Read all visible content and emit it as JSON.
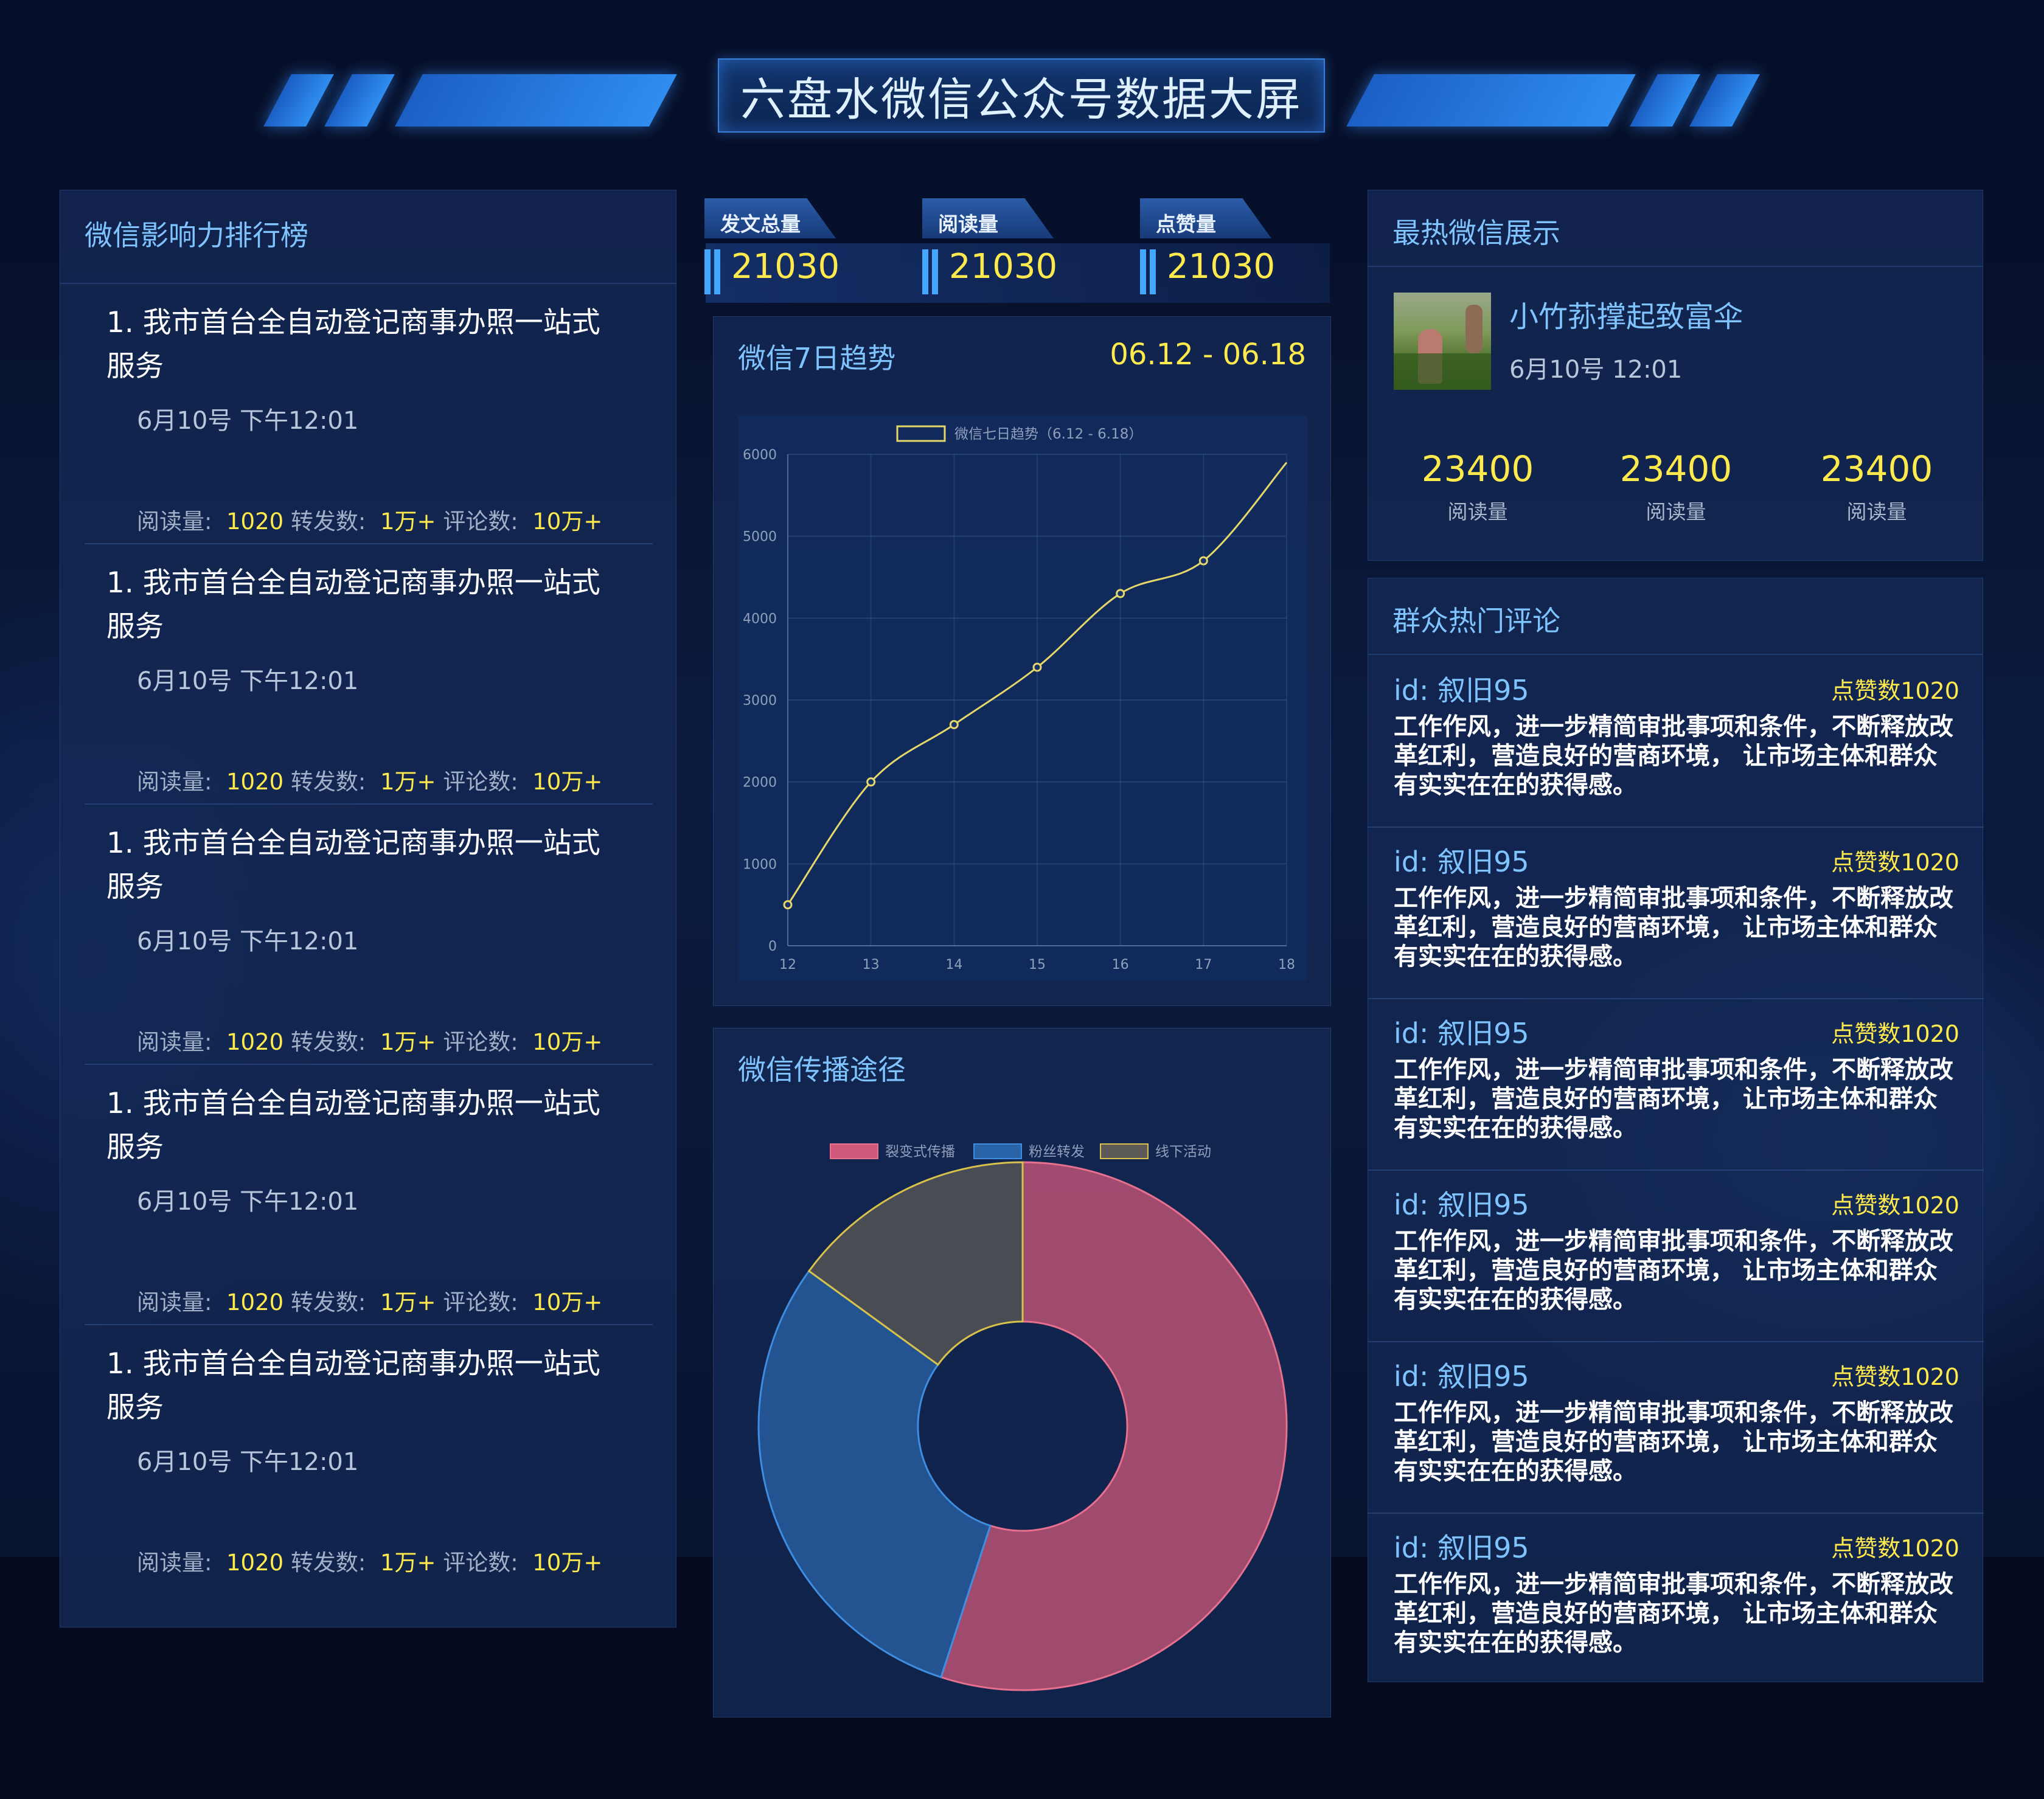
{
  "header": {
    "title": "六盘水微信公众号数据大屏"
  },
  "ranking": {
    "title": "微信影响力排行榜",
    "items": [
      {
        "title": "1. 我市首台全自动登记商事办照一站式服务",
        "date": "6月10号 下午12:01",
        "read_label": "阅读量:",
        "read": "1020",
        "share_label": "转发数:",
        "share": "1万+",
        "comment_label": "评论数:",
        "comment": "10万+"
      },
      {
        "title": "1. 我市首台全自动登记商事办照一站式服务",
        "date": "6月10号 下午12:01",
        "read_label": "阅读量:",
        "read": "1020",
        "share_label": "转发数:",
        "share": "1万+",
        "comment_label": "评论数:",
        "comment": "10万+"
      },
      {
        "title": "1. 我市首台全自动登记商事办照一站式服务",
        "date": "6月10号 下午12:01",
        "read_label": "阅读量:",
        "read": "1020",
        "share_label": "转发数:",
        "share": "1万+",
        "comment_label": "评论数:",
        "comment": "10万+"
      },
      {
        "title": "1. 我市首台全自动登记商事办照一站式服务",
        "date": "6月10号 下午12:01",
        "read_label": "阅读量:",
        "read": "1020",
        "share_label": "转发数:",
        "share": "1万+",
        "comment_label": "评论数:",
        "comment": "10万+"
      },
      {
        "title": "1. 我市首台全自动登记商事办照一站式服务",
        "date": "6月10号 下午12:01",
        "read_label": "阅读量:",
        "read": "1020",
        "share_label": "转发数:",
        "share": "1万+",
        "comment_label": "评论数:",
        "comment": "10万+"
      }
    ]
  },
  "stats": [
    {
      "label": "发文总量",
      "value": "21030"
    },
    {
      "label": "阅读量",
      "value": "21030"
    },
    {
      "label": "点赞量",
      "value": "21030"
    }
  ],
  "trend": {
    "title": "微信7日趋势",
    "range": "06.12 - 06.18"
  },
  "pie_panel": {
    "title": "微信传播途径"
  },
  "hot": {
    "title": "最热微信展示",
    "name": "小竹荪撑起致富伞",
    "date": "6月10号 12:01",
    "stats": [
      {
        "value": "23400",
        "label": "阅读量"
      },
      {
        "value": "23400",
        "label": "阅读量"
      },
      {
        "value": "23400",
        "label": "阅读量"
      }
    ]
  },
  "comments": {
    "title": "群众热门评论",
    "items": [
      {
        "id": "id: 叙旧95",
        "likes": "点赞数1020",
        "text": "工作作风，进一步精简审批事项和条件，不断释放改革红利，营造良好的营商环境， 让市场主体和群众有实实在在的获得感。"
      },
      {
        "id": "id: 叙旧95",
        "likes": "点赞数1020",
        "text": "工作作风，进一步精简审批事项和条件，不断释放改革红利，营造良好的营商环境， 让市场主体和群众有实实在在的获得感。"
      },
      {
        "id": "id: 叙旧95",
        "likes": "点赞数1020",
        "text": "工作作风，进一步精简审批事项和条件，不断释放改革红利，营造良好的营商环境， 让市场主体和群众有实实在在的获得感。"
      },
      {
        "id": "id: 叙旧95",
        "likes": "点赞数1020",
        "text": "工作作风，进一步精简审批事项和条件，不断释放改革红利，营造良好的营商环境， 让市场主体和群众有实实在在的获得感。"
      },
      {
        "id": "id: 叙旧95",
        "likes": "点赞数1020",
        "text": "工作作风，进一步精简审批事项和条件，不断释放改革红利，营造良好的营商环境， 让市场主体和群众有实实在在的获得感。"
      },
      {
        "id": "id: 叙旧95",
        "likes": "点赞数1020",
        "text": "工作作风，进一步精简审批事项和条件，不断释放改革红利，营造良好的营商环境， 让市场主体和群众有实实在在的获得感。"
      }
    ]
  },
  "chart_data": [
    {
      "type": "line",
      "legend": "微信七日趋势（6.12 - 6.18）",
      "x": [
        12,
        13,
        14,
        15,
        16,
        17,
        18
      ],
      "values": [
        500,
        2000,
        2700,
        3400,
        4300,
        4700,
        5900
      ],
      "ylim": [
        0,
        6000
      ],
      "yticks": [
        0,
        1000,
        2000,
        3000,
        4000,
        5000,
        6000
      ],
      "line_color": "#e5d868",
      "grid": true
    },
    {
      "type": "pie",
      "legend": [
        "裂变式传播",
        "粉丝转发",
        "线下活动"
      ],
      "values": [
        55,
        30,
        15
      ],
      "colors": [
        "#d0587a",
        "#2a64a8",
        "#5c5a56"
      ],
      "borders": [
        "#e8708f",
        "#3f8de0",
        "#d8c24a"
      ],
      "legend_position": "top"
    }
  ]
}
